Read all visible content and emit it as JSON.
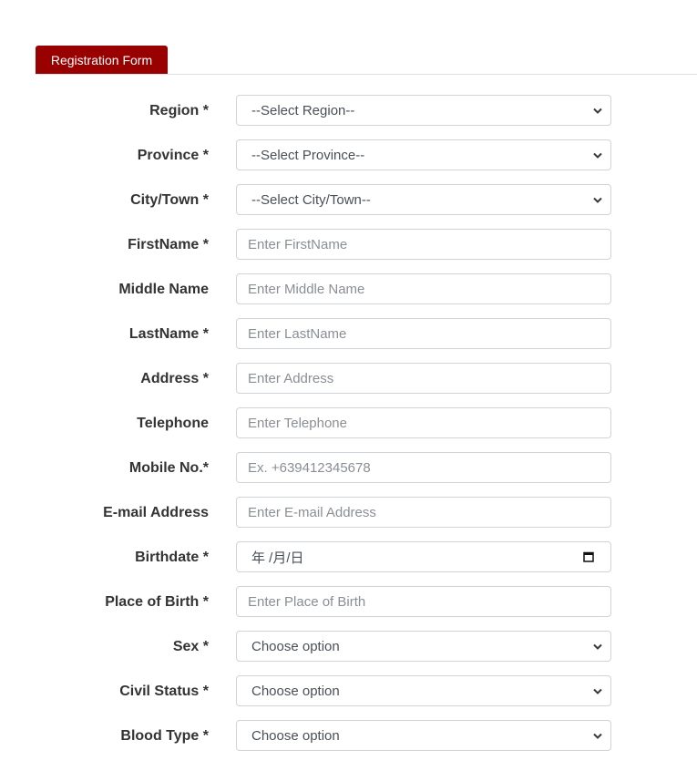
{
  "tabs": [
    {
      "label": "Registration Form",
      "active": true
    }
  ],
  "form": {
    "fields": [
      {
        "id": "region",
        "label": "Region *",
        "type": "select",
        "value": "--Select Region--"
      },
      {
        "id": "province",
        "label": "Province *",
        "type": "select",
        "value": "--Select Province--"
      },
      {
        "id": "city",
        "label": "City/Town *",
        "type": "select",
        "value": "--Select City/Town--"
      },
      {
        "id": "firstname",
        "label": "FirstName *",
        "type": "input",
        "placeholder": "Enter FirstName"
      },
      {
        "id": "middlename",
        "label": "Middle Name",
        "type": "input",
        "placeholder": "Enter Middle Name"
      },
      {
        "id": "lastname",
        "label": "LastName *",
        "type": "input",
        "placeholder": "Enter LastName"
      },
      {
        "id": "address",
        "label": "Address *",
        "type": "input",
        "placeholder": "Enter Address"
      },
      {
        "id": "telephone",
        "label": "Telephone",
        "type": "input",
        "placeholder": "Enter Telephone"
      },
      {
        "id": "mobile",
        "label": "Mobile No.*",
        "type": "input",
        "placeholder": "Ex. +639412345678"
      },
      {
        "id": "email",
        "label": "E-mail Address",
        "type": "input",
        "placeholder": "Enter E-mail Address"
      },
      {
        "id": "birthdate",
        "label": "Birthdate *",
        "type": "date",
        "value": "年 /月/日"
      },
      {
        "id": "birthplace",
        "label": "Place of Birth *",
        "type": "input",
        "placeholder": "Enter Place of Birth"
      },
      {
        "id": "sex",
        "label": "Sex *",
        "type": "select",
        "value": "Choose option"
      },
      {
        "id": "civilstatus",
        "label": "Civil Status *",
        "type": "select",
        "value": "Choose option"
      },
      {
        "id": "bloodtype",
        "label": "Blood Type *",
        "type": "select",
        "value": "Choose option"
      }
    ]
  },
  "colors": {
    "tab_active": "#990000",
    "border": "#ced4da"
  }
}
